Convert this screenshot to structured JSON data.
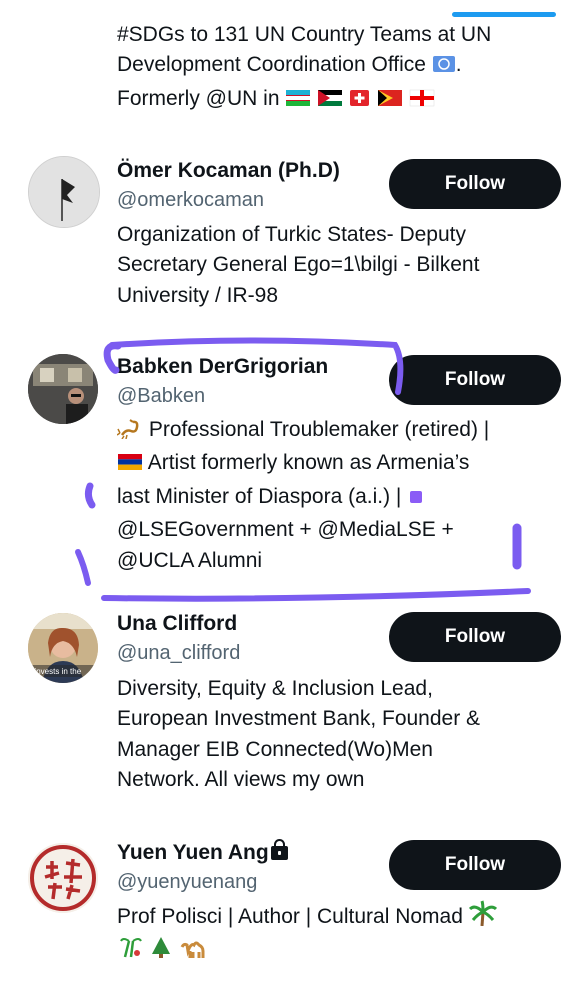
{
  "top_bio": {
    "line1": "#SDGs to 131 UN Country Teams at UN",
    "line2": "Development Coordination Office",
    "line3": "Formerly @UN in"
  },
  "users": [
    {
      "name": "Ömer Kocaman (Ph.D)",
      "handle": "@omerkocaman",
      "bio": [
        "Organization of Turkic States- Deputy",
        "Secretary General Ego=1\\bilgi - Bilkent",
        "University / IR-98"
      ],
      "follow_label": "Follow"
    },
    {
      "name": "Babken DerGrigorian",
      "handle": "@Babken",
      "bio": [
        "Professional Troublemaker (retired) |",
        "Artist formerly known as Armenia’s",
        "last Minister of Diaspora (a.i.) |",
        "@LSEGovernment + @MediaLSE +",
        "@UCLA Alumni"
      ],
      "follow_label": "Follow"
    },
    {
      "name": "Una Clifford",
      "handle": "@una_clifford",
      "avatar_text": "t invests in the",
      "bio": [
        "Diversity, Equity & Inclusion Lead,",
        "European Investment Bank, Founder &",
        "Manager EIB Connected(Wo)Men",
        "Network. All views my own"
      ],
      "follow_label": "Follow"
    },
    {
      "name": "Yuen Yuen Ang",
      "handle": "@yuenyuenang",
      "bio": [
        "Prof Polisci | Author | Cultural Nomad"
      ],
      "follow_label": "Follow"
    }
  ],
  "colors": {
    "follow_bg": "#0f1419",
    "handle": "#536471",
    "marker": "#7b5cf0",
    "accent": "#1d9bf0"
  },
  "icons": [
    "un-flag-icon",
    "uzbekistan-flag-icon",
    "jordan-flag-icon",
    "switzerland-flag-icon",
    "timor-leste-flag-icon",
    "georgia-flag-icon",
    "scorpion-icon",
    "armenia-flag-icon",
    "purple-square-icon",
    "lock-icon",
    "palm-tree-icon",
    "christmas-tree-icon",
    "camel-icon"
  ]
}
